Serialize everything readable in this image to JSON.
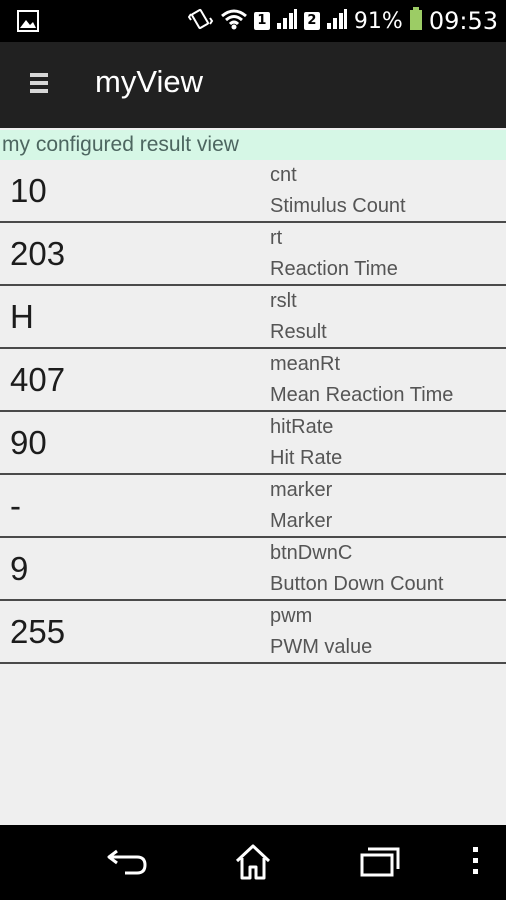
{
  "status_bar": {
    "sim1": "1",
    "sim2": "2",
    "battery": "91%",
    "time": "09:53",
    "icons": [
      "gallery-icon",
      "vibrate-icon",
      "wifi-icon",
      "signal-icon",
      "battery-icon"
    ]
  },
  "app_bar": {
    "title": "myView",
    "menu_icon": "hamburger-menu-icon"
  },
  "view_header": "my configured result view",
  "results": [
    {
      "value": "10",
      "key": "cnt",
      "desc": "Stimulus Count"
    },
    {
      "value": "203",
      "key": "rt",
      "desc": "Reaction Time"
    },
    {
      "value": "H",
      "key": "rslt",
      "desc": "Result"
    },
    {
      "value": "407",
      "key": "meanRt",
      "desc": "Mean Reaction Time"
    },
    {
      "value": "90",
      "key": "hitRate",
      "desc": "Hit Rate"
    },
    {
      "value": "-",
      "key": "marker",
      "desc": "Marker"
    },
    {
      "value": "9",
      "key": "btnDwnC",
      "desc": "Button Down Count"
    },
    {
      "value": "255",
      "key": "pwm",
      "desc": "PWM value"
    }
  ],
  "nav_bar": {
    "icons": [
      "back-icon",
      "home-icon",
      "recent-apps-icon",
      "overflow-menu-icon"
    ]
  }
}
